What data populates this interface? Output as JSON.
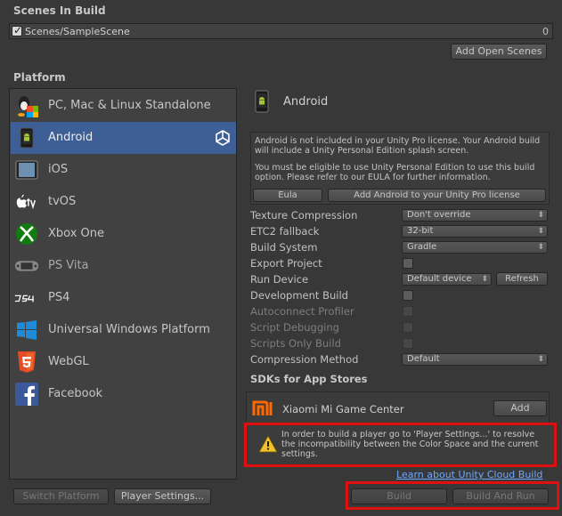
{
  "scenes": {
    "header": "Scenes In Build",
    "items": [
      {
        "name": "Scenes/SampleScene",
        "index": "0",
        "checked": true
      }
    ],
    "add_open_scenes": "Add Open Scenes"
  },
  "platform": {
    "header": "Platform",
    "items": [
      {
        "label": "PC, Mac & Linux Standalone",
        "icon": "linux-penguin-icon"
      },
      {
        "label": "Android",
        "icon": "android-icon",
        "selected": true
      },
      {
        "label": "iOS",
        "icon": "ipad-icon"
      },
      {
        "label": "tvOS",
        "icon": "apple-tv-icon"
      },
      {
        "label": "Xbox One",
        "icon": "xbox-icon"
      },
      {
        "label": "PS Vita",
        "icon": "ps-vita-icon"
      },
      {
        "label": "PS4",
        "icon": "ps4-icon"
      },
      {
        "label": "Universal Windows Platform",
        "icon": "windows-icon"
      },
      {
        "label": "WebGL",
        "icon": "html5-icon"
      },
      {
        "label": "Facebook",
        "icon": "facebook-icon"
      }
    ],
    "switch_platform": "Switch Platform",
    "player_settings": "Player Settings..."
  },
  "android": {
    "title": "Android",
    "info_line1": "Android is not included in your Unity Pro license. Your Android build will include a Unity Personal Edition splash screen.",
    "info_line2": "You must be eligible to use Unity Personal Edition to use this build option. Please refer to our EULA for further information.",
    "eula": "Eula",
    "add_license": "Add Android to your Unity Pro license",
    "settings": {
      "texture_compression": {
        "label": "Texture Compression",
        "value": "Don't override"
      },
      "etc2_fallback": {
        "label": "ETC2 fallback",
        "value": "32-bit"
      },
      "build_system": {
        "label": "Build System",
        "value": "Gradle"
      },
      "export_project": {
        "label": "Export Project"
      },
      "run_device": {
        "label": "Run Device",
        "value": "Default device",
        "refresh": "Refresh"
      },
      "development_build": {
        "label": "Development Build"
      },
      "autoconnect_profiler": {
        "label": "Autoconnect Profiler"
      },
      "script_debugging": {
        "label": "Script Debugging"
      },
      "scripts_only_build": {
        "label": "Scripts Only Build"
      },
      "compression_method": {
        "label": "Compression Method",
        "value": "Default"
      }
    },
    "sdks_header": "SDKs for App Stores",
    "sdk_name": "Xiaomi Mi Game Center",
    "sdk_add": "Add",
    "warning": "In order to build a player go to 'Player Settings...' to resolve the incompatibility between the Color Space and the current settings.",
    "cloud_link": "Learn about Unity Cloud Build",
    "build": "Build",
    "build_and_run": "Build And Run"
  },
  "colors": {
    "selection": "#3e5f96",
    "highlight_red": "#e01010",
    "link": "#6fa8ff"
  }
}
